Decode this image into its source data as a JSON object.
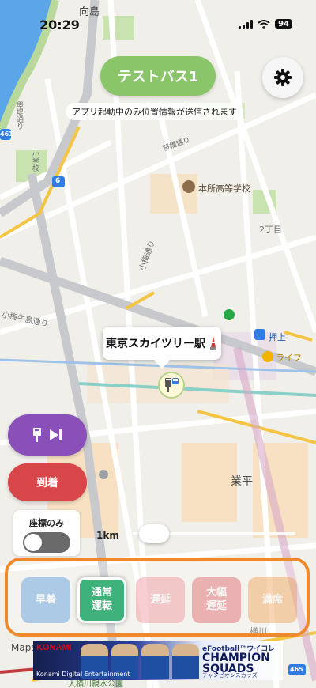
{
  "status_bar": {
    "time": "20:29",
    "battery": "94"
  },
  "header": {
    "title": "テストバス1",
    "notice": "アプリ起動中のみ位置情報が送信されます"
  },
  "map": {
    "labels": {
      "mukojima": "向島",
      "sakuraba": "桜橋通り",
      "honjo_school": "本所高等学校",
      "nichome": "2丁目",
      "koume": "小梅通り",
      "koumeushi": "小梅牛島通り",
      "oshiage": "押上",
      "life": "ライフ",
      "gyohei": "業平",
      "yokokawa": "横川",
      "park": "大横川親水公園",
      "route6": "6",
      "route461": "461",
      "route465": "465",
      "sumida_left": "墨堤通り",
      "sumida_left2": "小学校",
      "maps_logo": "Maps"
    }
  },
  "stop": {
    "name": "東京スカイツリー駅"
  },
  "controls": {
    "arrive": "到着",
    "coords_only": "座標のみ",
    "coords_only_enabled": false,
    "range": "1km",
    "range_slider_fraction": 0.05
  },
  "statuses": [
    {
      "label": "早着",
      "color": "#4a90d9",
      "active": false
    },
    {
      "label": "通常\n運転",
      "color": "#3fb17a",
      "active": true
    },
    {
      "label": "遅延",
      "color": "#f18d96",
      "active": false
    },
    {
      "label": "大幅\n遅延",
      "color": "#e0565e",
      "active": false
    },
    {
      "label": "満席",
      "color": "#ef9a4a",
      "active": false
    }
  ],
  "ad": {
    "brand": "KONAMI",
    "sub": "Konami Digital Entertainment",
    "title_a": "eFootball™ウイコレ",
    "title_b": "CHAMPION SQUADS",
    "title_c": "チャンピオンスカッズ"
  },
  "colors": {
    "accent_green": "#8bc56a",
    "skip_purple": "#8a4fb9",
    "arrive_red": "#d9464a",
    "panel_orange": "#ef8a2c"
  }
}
